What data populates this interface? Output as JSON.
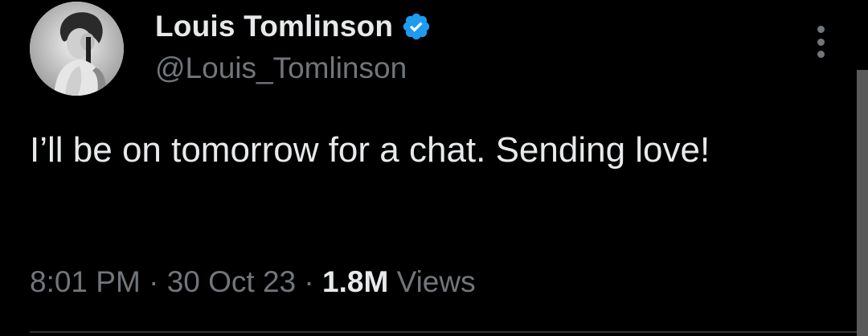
{
  "author": {
    "display_name": "Louis Tomlinson",
    "handle": "@Louis_Tomlinson",
    "verified": true,
    "avatar": "profile-photo"
  },
  "tweet": {
    "text": "I’ll be on tomorrow for a chat. Sending love!"
  },
  "meta": {
    "time": "8:01 PM",
    "separator": "·",
    "date": "30 Oct 23",
    "views_count": "1.8M",
    "views_label": "Views"
  },
  "icons": {
    "verified": "verified-badge-icon",
    "more": "more-options-icon"
  },
  "colors": {
    "background": "#000000",
    "primary_text": "#e7e9ea",
    "secondary_text": "#71767b",
    "verified_blue": "#1d9bf0"
  }
}
